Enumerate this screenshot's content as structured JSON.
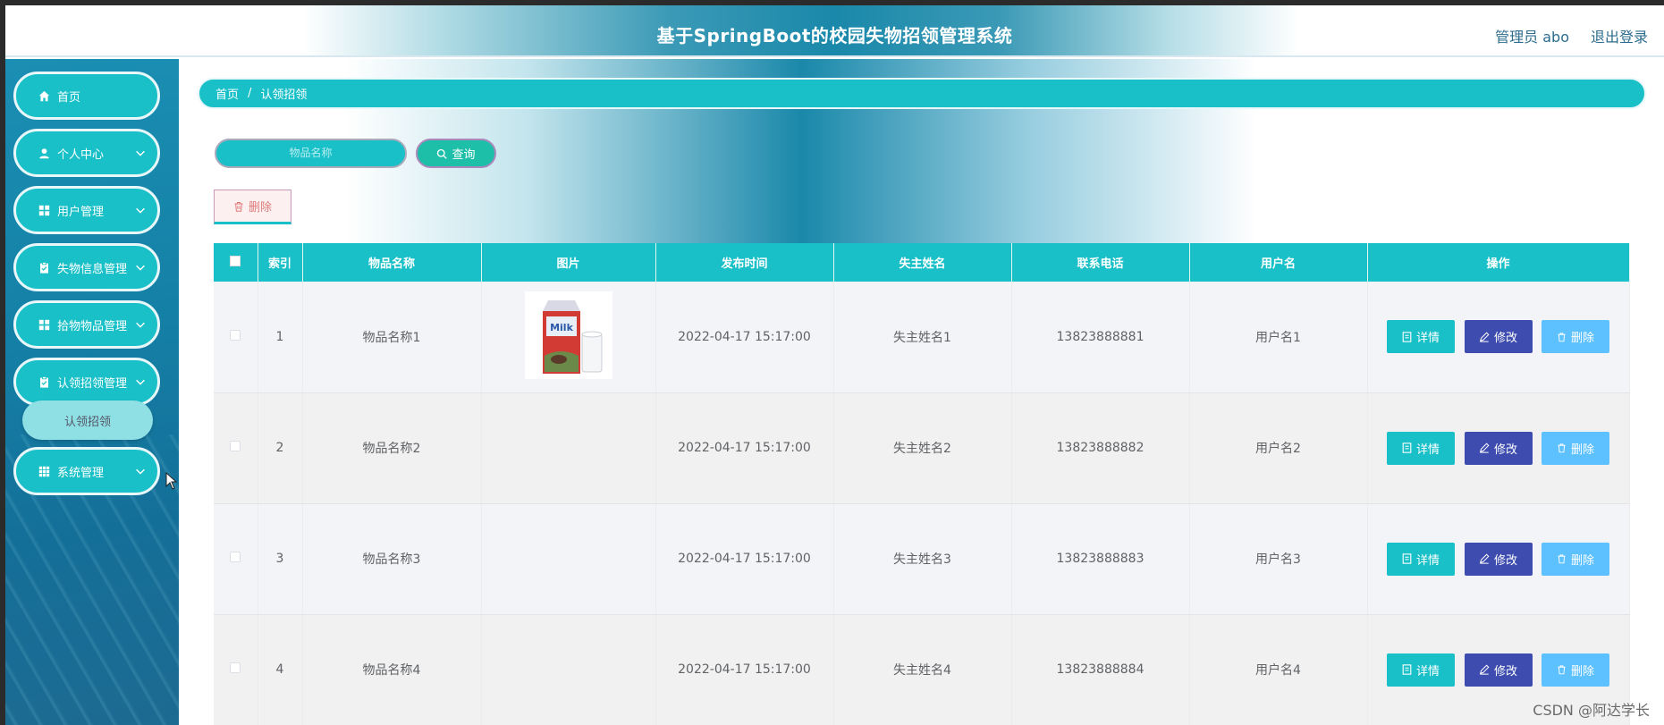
{
  "header": {
    "title": "基于SpringBoot的校园失物招领管理系统",
    "user": "管理员 abo",
    "logout": "退出登录"
  },
  "sidebar": {
    "items": [
      {
        "label": "首页",
        "icon": "home-icon"
      },
      {
        "label": "个人中心",
        "icon": "user-icon"
      },
      {
        "label": "用户管理",
        "icon": "grid-icon"
      },
      {
        "label": "失物信息管理",
        "icon": "clipboard-icon"
      },
      {
        "label": "拾物物品管理",
        "icon": "grid-icon"
      },
      {
        "label": "认领招领管理",
        "icon": "clipboard-icon"
      },
      {
        "label": "系统管理",
        "icon": "grid-icon"
      }
    ],
    "submenu": "认领招领"
  },
  "breadcrumb": [
    "首页",
    "认领招领"
  ],
  "search": {
    "placeholder": "物品名称",
    "button": "查询"
  },
  "toolbar": {
    "delete": "删除"
  },
  "table": {
    "columns": [
      "索引",
      "物品名称",
      "图片",
      "发布时间",
      "失主姓名",
      "联系电话",
      "用户名",
      "操作"
    ],
    "rows": [
      {
        "index": "1",
        "name": "物品名称1",
        "has_image": true,
        "time": "2022-04-17 15:17:00",
        "owner": "失主姓名1",
        "phone": "13823888881",
        "user": "用户名1"
      },
      {
        "index": "2",
        "name": "物品名称2",
        "has_image": false,
        "time": "2022-04-17 15:17:00",
        "owner": "失主姓名2",
        "phone": "13823888882",
        "user": "用户名2"
      },
      {
        "index": "3",
        "name": "物品名称3",
        "has_image": false,
        "time": "2022-04-17 15:17:00",
        "owner": "失主姓名3",
        "phone": "13823888883",
        "user": "用户名3"
      },
      {
        "index": "4",
        "name": "物品名称4",
        "has_image": false,
        "time": "2022-04-17 15:17:00",
        "owner": "失主姓名4",
        "phone": "13823888884",
        "user": "用户名4"
      }
    ],
    "actions": {
      "detail": "详情",
      "edit": "修改",
      "delete": "删除"
    }
  },
  "watermark": "CSDN @阿达学长",
  "colors": {
    "primary": "#19c0c8",
    "edit": "#3d4cae",
    "delete": "#5ec1ff"
  }
}
